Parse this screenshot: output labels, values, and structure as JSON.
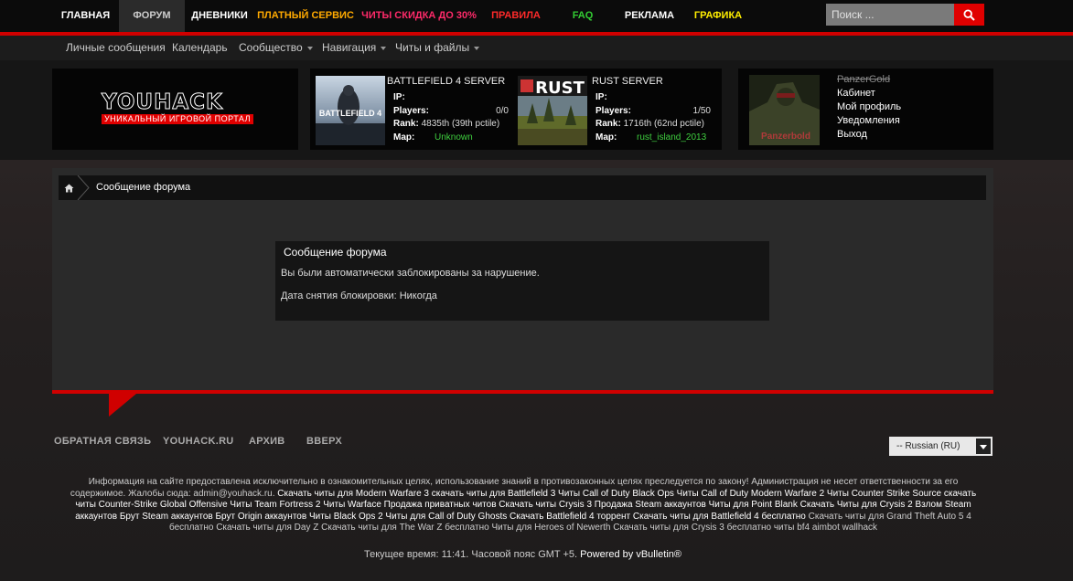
{
  "nav": {
    "items": [
      {
        "label": "ГЛАВНАЯ",
        "color": "#ffffff"
      },
      {
        "label": "ФОРУМ",
        "color": "#cccccc"
      },
      {
        "label": "ДНЕВНИКИ",
        "color": "#ffffff"
      },
      {
        "label": "ПЛАТНЫЙ СЕРВИС",
        "color": "#ffaa00"
      },
      {
        "label": "ЧИТЫ СКИДКА ДО 30%",
        "color": "#ff2a6a"
      },
      {
        "label": "ПРАВИЛА",
        "color": "#ff2a2a"
      },
      {
        "label": "FAQ",
        "color": "#33cc33"
      },
      {
        "label": "РЕКЛАМА",
        "color": "#ffffff"
      },
      {
        "label": "ГРАФИКА",
        "color": "#ffee00"
      }
    ],
    "search_placeholder": "Поиск ..."
  },
  "subnav": {
    "items": [
      "Личные сообщения",
      "Календарь",
      "Сообщество",
      "Навигация",
      "Читы и файлы"
    ]
  },
  "logo": {
    "title": "YOUHACK",
    "subtitle": "УНИКАЛЬНЫЙ ИГРОВОЙ ПОРТАЛ"
  },
  "servers": [
    {
      "title": "BATTLEFIELD 4 SERVER",
      "thumb_text": "BATTLEFIELD 4",
      "ip_label": "IP:",
      "players_label": "Players:",
      "players": "0/0",
      "rank_label": "Rank:",
      "rank": "4835th (39th pctile)",
      "map_label": "Map:",
      "map": "Unknown"
    },
    {
      "title": "RUST SERVER",
      "thumb_text": "RUST",
      "ip_label": "IP:",
      "players_label": "Players:",
      "players": "1/50",
      "rank_label": "Rank:",
      "rank": "1716th (62nd pctile)",
      "map_label": "Map:",
      "map": "rust_island_2013"
    }
  ],
  "user": {
    "name": "PanzerGold",
    "avatar_text": "Panzerbold",
    "links": [
      "Кабинет",
      "Мой профиль",
      "Уведомления",
      "Выход"
    ]
  },
  "breadcrumb": {
    "current": "Сообщение форума"
  },
  "message": {
    "title": "Сообщение форума",
    "text": "Вы были автоматически заблокированы за нарушение.",
    "unban": "Дата снятия блокировки: Никогда"
  },
  "footer": {
    "links": [
      "ОБРАТНАЯ СВЯЗЬ",
      "YOUHACK.RU",
      "АРХИВ",
      "ВВЕРХ"
    ],
    "language": "-- Russian (RU)",
    "disclaimer_intro": "Информация на сайте предоставлена исключительно в ознакомительных целях, использование знаний в противозаконных целях преследуется по закону! Администрация не несет ответственности за его содержимое. Жалобы сюда: admin@youhack.ru.",
    "disclaimer_keywords": "Скачать читы для Modern Warfare 3 скачать читы для Battlefield 3 Читы Call of Duty Black Ops Читы Call of Duty Modern Warfare 2 Читы Counter Strike Source скачать читы Counter-Strike Global Offensive Читы Team Fortress 2 Читы Warface Продажа приватных читов Скачать читы Crysis 3 Продажа Steam аккаунтов Читы для Point Blank Скачать Читы для Crysis 2 Взлом Steam аккаунтов Брут Steam аккаунтов Брут Origin аккаунтов Читы Black Ops 2 Читы для Call of Duty Ghosts Скачать Battlefield 4 торрент Скачать читы для Battlefield 4 бесплатно",
    "disclaimer_tail": "Скачать читы для Grand Theft Auto 5 4 бесплатно Скачать читы для Day Z Скачать читы для The War Z бесплатно Читы для Heroes of Newerth Скачать читы для Crysis 3 бесплатно читы bf4 aimbot wallhack",
    "time_text": "Текущее время: 11:41. Часовой пояс GMT +5.",
    "powered": "Powered by vBulletin®"
  },
  "colors": {
    "accent": "#d00000",
    "map_value": "#3fcf3f"
  }
}
